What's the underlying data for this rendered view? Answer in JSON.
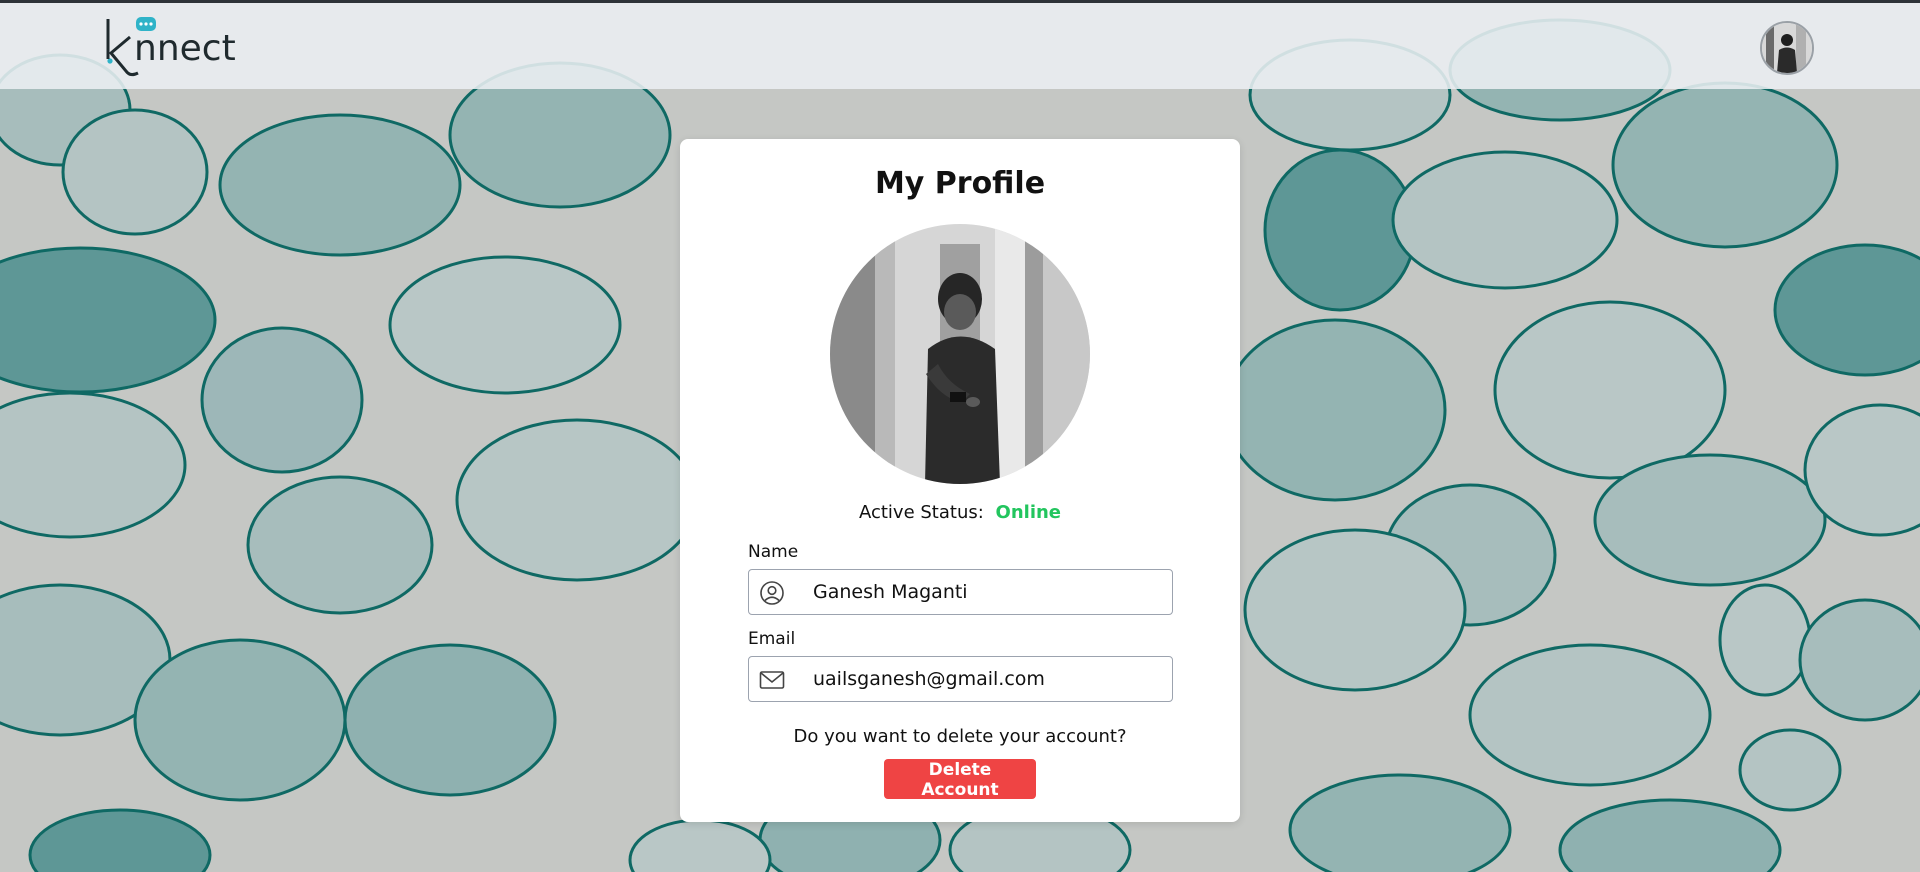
{
  "app": {
    "logo_text": "knnect"
  },
  "profile": {
    "title": "My Profile",
    "active_status_label": "Active Status:",
    "active_status_value": "Online",
    "name_label": "Name",
    "name_value": "Ganesh Maganti",
    "email_label": "Email",
    "email_value": "uailsganesh@gmail.com",
    "delete_question": "Do you want to delete your account?",
    "delete_button_label": "Delete Account"
  },
  "colors": {
    "status_online": "#22c55e",
    "delete_button": "#ef4444",
    "brand_accent": "#2fb3c8",
    "bubble_outline": "#0f6964"
  },
  "icons": {
    "name_field": "user-circle-icon",
    "email_field": "envelope-icon",
    "logo_bubble": "chat-bubble-icon"
  }
}
